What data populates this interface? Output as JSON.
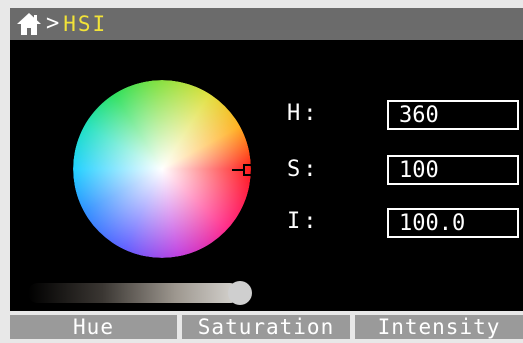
{
  "header": {
    "title": "HSI",
    "separator": ">",
    "home_icon": "home-icon"
  },
  "values": {
    "h_label": "H:",
    "h_value": "360",
    "s_label": "S:",
    "s_value": "100",
    "i_label": "I:",
    "i_value": "100.0"
  },
  "brightness_slider": {
    "value_fraction": 1.0
  },
  "tabs": [
    {
      "label": "Hue"
    },
    {
      "label": "Saturation"
    },
    {
      "label": "Intensity"
    }
  ],
  "colors": {
    "title": "#f2e338",
    "header_bg": "#6b6b6b",
    "tab_bg": "#9a9a9a"
  }
}
